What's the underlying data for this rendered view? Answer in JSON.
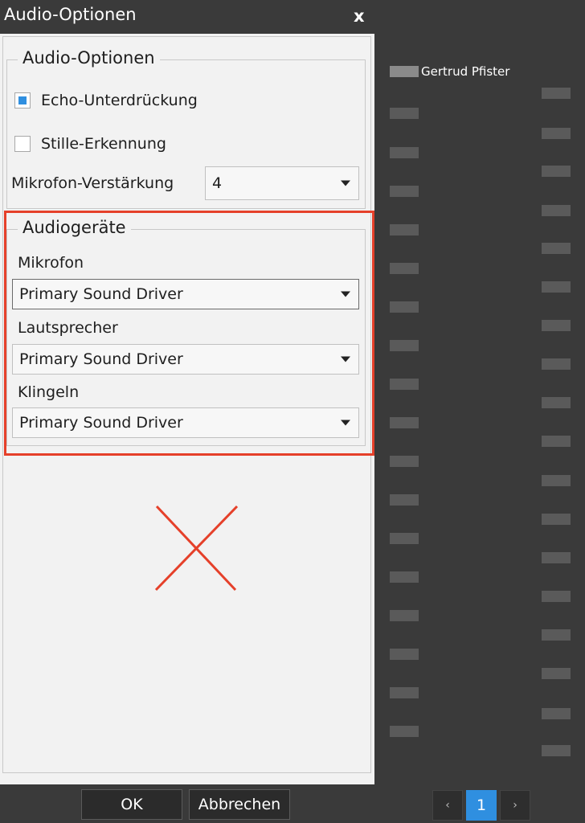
{
  "dialog": {
    "title": "Audio-Optionen",
    "close_label": "x",
    "audio_options": {
      "legend": "Audio-Optionen",
      "echo_label": "Echo-Unterdrückung",
      "echo_checked": true,
      "silence_label": "Stille-Erkennung",
      "silence_checked": false,
      "gain_label": "Mikrofon-Verstärkung",
      "gain_value": "4"
    },
    "audio_devices": {
      "legend": "Audiogeräte",
      "mic_label": "Mikrofon",
      "mic_value": "Primary Sound Driver",
      "speaker_label": "Lautsprecher",
      "speaker_value": "Primary Sound Driver",
      "ring_label": "Klingeln",
      "ring_value": "Primary Sound Driver"
    },
    "ok_label": "OK",
    "cancel_label": "Abbrechen"
  },
  "participants": {
    "first_name": "Gertrud Pfister"
  },
  "pagination": {
    "prev": "‹",
    "current": "1",
    "next": "›"
  },
  "colors": {
    "accent": "#2f8fe0",
    "highlight": "#e5402a",
    "background": "#3a3a3a",
    "panel": "#f2f2f2"
  }
}
